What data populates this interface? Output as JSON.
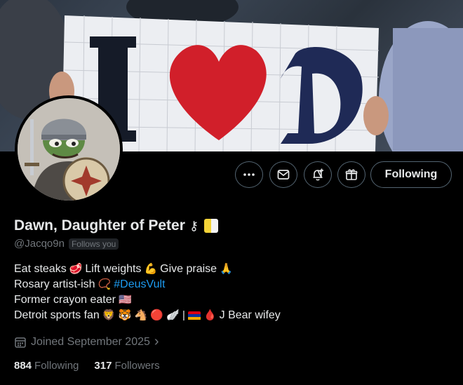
{
  "banner": {
    "sign_text": "I ♥ D"
  },
  "actions": {
    "more_icon": "more-icon",
    "message_icon": "mail-icon",
    "notify_icon": "bell-plus-icon",
    "subscribe_icon": "gift-icon",
    "follow_label": "Following"
  },
  "profile": {
    "name": "Dawn, Daughter of Peter",
    "name_glyph": "⚷",
    "handle": "@Jacqo9n",
    "follows_you": "Follows you"
  },
  "bio": {
    "line1": {
      "a": "Eat steaks",
      "b": "Lift weights",
      "c": "Give praise",
      "e1": "🥩",
      "e2": "💪",
      "e3": "🙏"
    },
    "line2": {
      "a": "Rosary artist-ish",
      "e1": "📿",
      "hashtag": "#DeusVult"
    },
    "line3": {
      "a": "Former crayon eater",
      "e1": "🇺🇸"
    },
    "line4": {
      "a": "Detroit sports fan",
      "emojis": "🦁 🐯 🐴 🔴 🪽 |",
      "e_drop": "🩸",
      "b": "J Bear wifey"
    }
  },
  "joined": {
    "icon": "calendar-icon",
    "text": "Joined September 2025",
    "chevron": "›"
  },
  "stats": {
    "following_count": "884",
    "following_label": "Following",
    "followers_count": "317",
    "followers_label": "Followers"
  },
  "colors": {
    "accent": "#1d9bf0",
    "muted": "#71767b",
    "text": "#e7e9ea",
    "border": "#536471"
  }
}
